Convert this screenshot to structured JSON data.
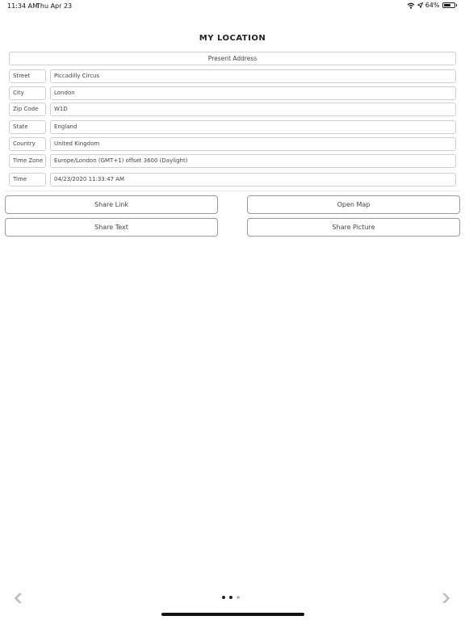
{
  "status_bar": {
    "time": "11:34 AM",
    "date": "Thu Apr 23",
    "battery_text": "64%",
    "icons": [
      "wifi-icon",
      "location-arrow-icon",
      "battery-icon"
    ]
  },
  "title": "MY LOCATION",
  "present_address_label": "Present Address",
  "fields": [
    {
      "label": "Street",
      "value": "Piccadilly Circus"
    },
    {
      "label": "City",
      "value": "London"
    },
    {
      "label": "Zip Code",
      "value": "W1D"
    },
    {
      "label": "State",
      "value": "England"
    },
    {
      "label": "Country",
      "value": "United Kingdom"
    },
    {
      "label": "Time Zone",
      "value": "Europe/London (GMT+1) offset 3600 (Daylight)"
    },
    {
      "label": "Time",
      "value": "04/23/2020 11:33:47 AM"
    }
  ],
  "buttons": {
    "share_link": "Share Link",
    "open_map": "Open Map",
    "share_text": "Share Text",
    "share_picture": "Share Picture"
  },
  "pager": {
    "pages": 3,
    "active": 2,
    "icons": [
      "chevron-left-icon",
      "chevron-right-icon"
    ]
  }
}
